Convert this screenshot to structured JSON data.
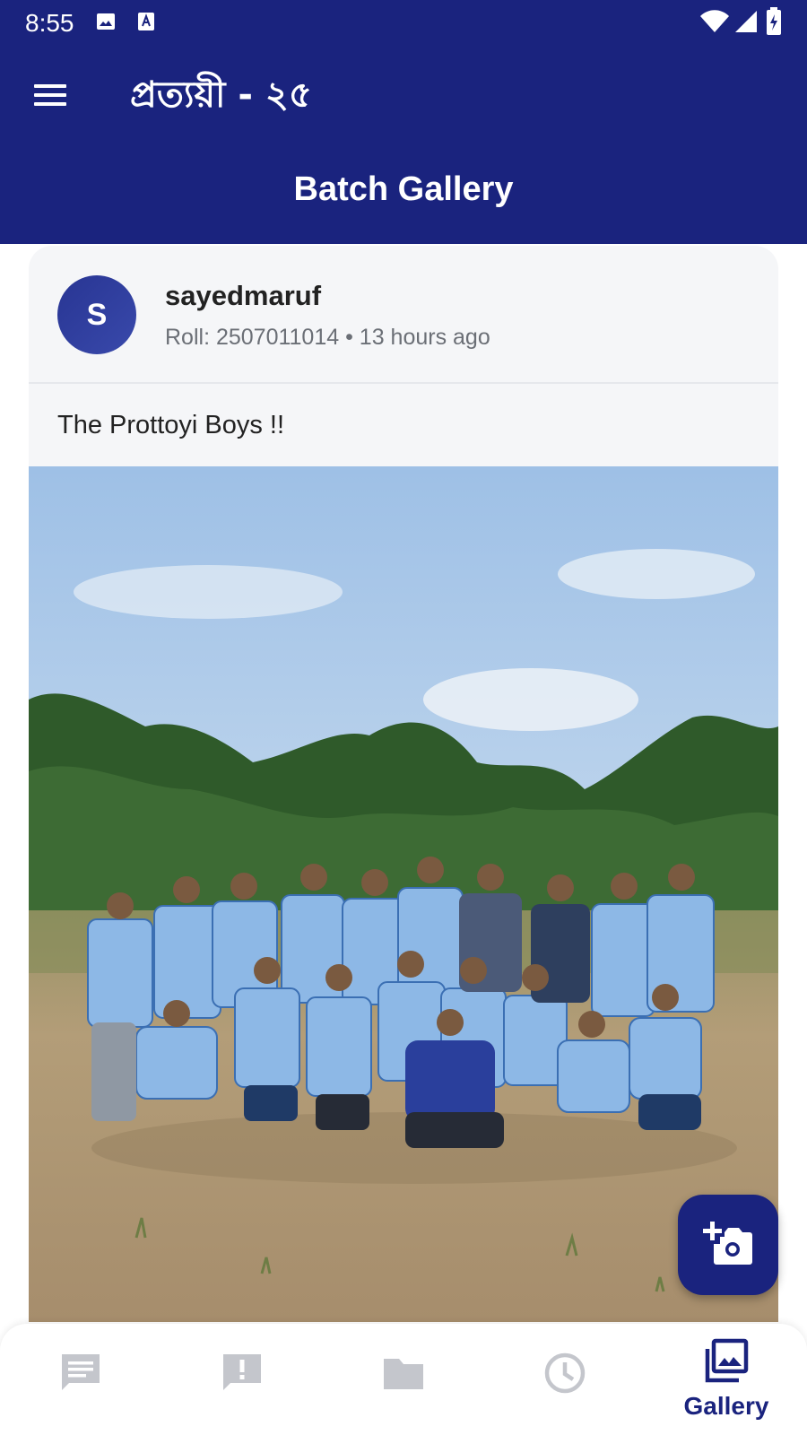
{
  "status_bar": {
    "time": "8:55"
  },
  "app": {
    "title": "প্রত্যয়ী - ২৫"
  },
  "page": {
    "title": "Batch Gallery"
  },
  "post": {
    "avatar_initial": "S",
    "username": "sayedmaruf",
    "meta": "Roll: 2507011014 • 13 hours ago",
    "caption": "The Prottoyi Boys !!"
  },
  "bottom_nav": {
    "items": [
      {
        "icon": "chat-icon",
        "label": ""
      },
      {
        "icon": "report-icon",
        "label": ""
      },
      {
        "icon": "folder-icon",
        "label": ""
      },
      {
        "icon": "clock-icon",
        "label": ""
      },
      {
        "icon": "gallery-icon",
        "label": "Gallery",
        "active": true
      }
    ]
  },
  "colors": {
    "primary": "#1a237e",
    "inactive_icon": "#c4c6cc",
    "card_bg": "#f5f6f8"
  }
}
